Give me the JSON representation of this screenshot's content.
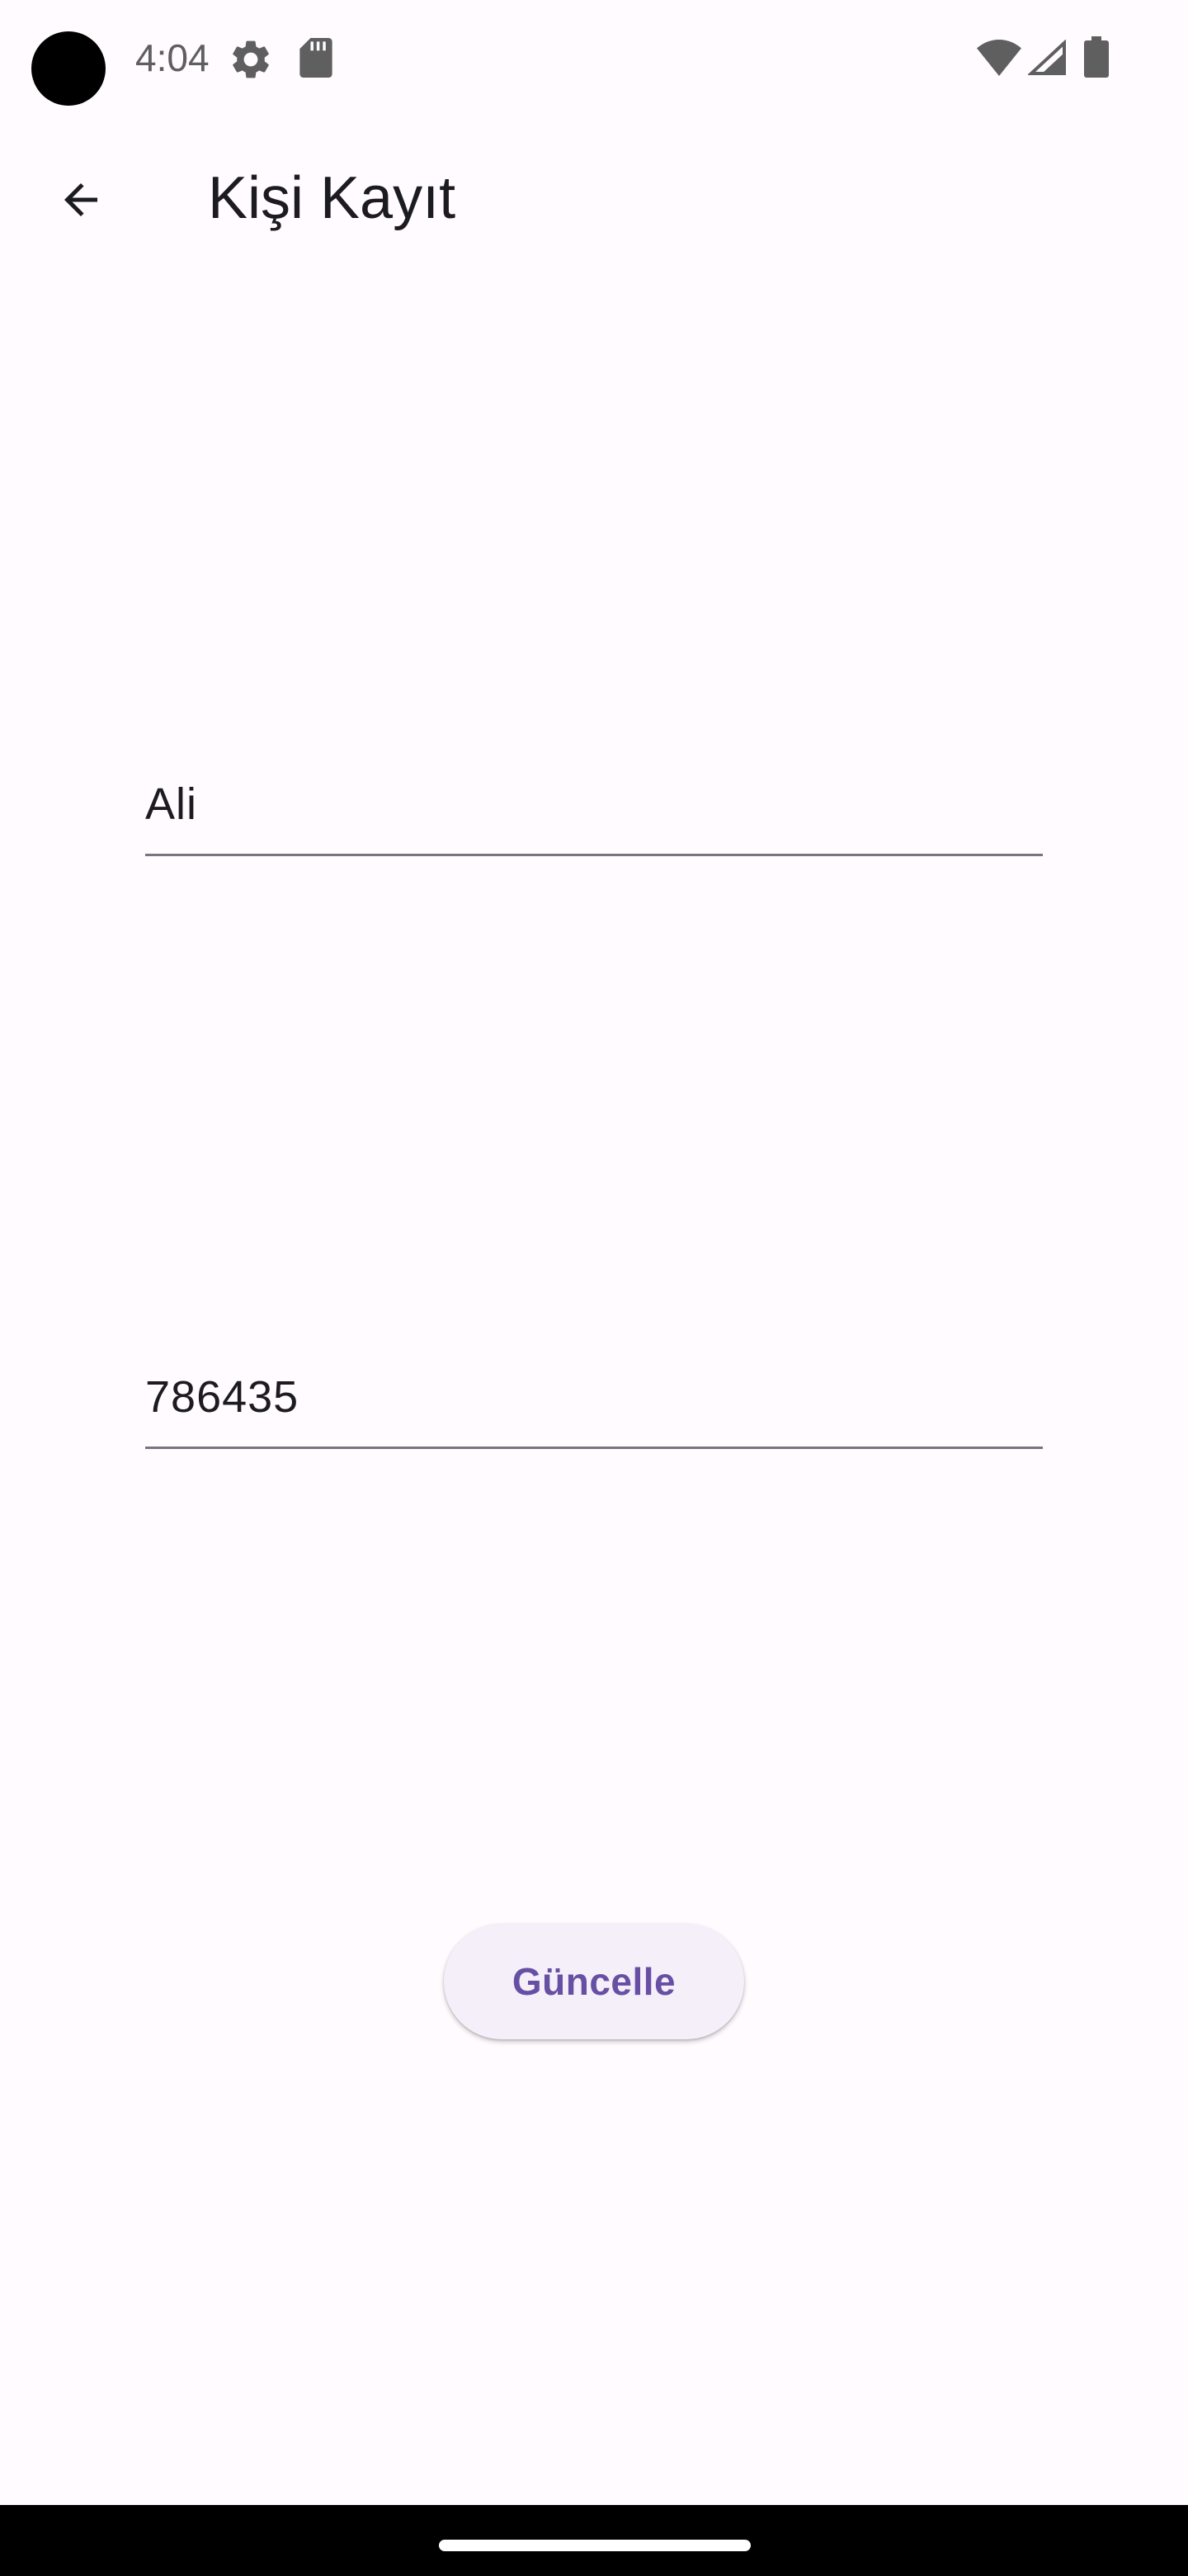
{
  "status_bar": {
    "time": "4:04",
    "icons": [
      "camera-dot",
      "gear-icon",
      "sd-card-icon",
      "wifi-icon",
      "signal-icon",
      "battery-icon"
    ]
  },
  "app_bar": {
    "back_icon": "arrow-back-icon",
    "title": "Kişi Kayıt"
  },
  "form": {
    "name_value": "Ali",
    "number_value": "786435",
    "update_label": "Güncelle"
  },
  "colors": {
    "background": "#fffbfe",
    "primary": "#6750a4",
    "button_surface": "#f5eff9",
    "field_underline": "#79747e",
    "text": "#1c1b1f"
  }
}
